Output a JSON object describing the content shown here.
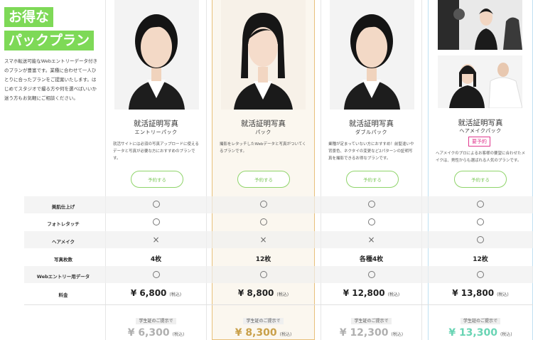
{
  "intro": {
    "heading_line1": "お得な",
    "heading_line2": "パックプラン",
    "description": "スマホ転送可能なWebエントリーデータ付きのプランが豊富です。業種に合わせて一人ひとりに合ったプランをご提案いたします。はじめてスタジオで撮る方や何を選べばいいか迷う方もお気軽にご相談ください。"
  },
  "plans": [
    {
      "title": "就活証明写真",
      "subtitle": "エントリーパック",
      "description": "就活サイトには必須の写真アップロードに使えるデータと写真が必要な方におすすめのプランです。",
      "button": "予約する",
      "badge": "",
      "price": "¥ 6,800",
      "student_price": "¥ 6,300"
    },
    {
      "title": "就活証明写真",
      "subtitle": "パック",
      "description": "撮影をレタッチしたWebデータと写真がついてくるプランです。",
      "button": "予約する",
      "badge": "",
      "price": "¥ 8,800",
      "student_price": "¥ 8,300"
    },
    {
      "title": "就活証明写真",
      "subtitle": "ダブルパック",
      "description": "業種が定まっていない方におすすめ！前髪違いや背景色、ネクタイの変更など2パターンの証明写真を撮影できるお得なプランです。",
      "button": "予約する",
      "badge": "",
      "price": "¥ 12,800",
      "student_price": "¥ 12,300"
    },
    {
      "title": "就活証明写真",
      "subtitle": "ヘアメイクパック",
      "description": "ヘアメイクのプロによるお客様の要望に合わせたメイクは、男性からも選ばれる人気のプランです。",
      "button": "予約する",
      "badge": "要予約",
      "price": "¥ 13,800",
      "student_price": "¥ 13,300"
    }
  ],
  "table": {
    "rows": [
      {
        "label": "美肌仕上げ",
        "values": [
          "○",
          "○",
          "○",
          "○"
        ]
      },
      {
        "label": "フォトレタッチ",
        "values": [
          "○",
          "○",
          "○",
          "○"
        ]
      },
      {
        "label": "ヘアメイク",
        "values": [
          "×",
          "×",
          "×",
          "○"
        ]
      },
      {
        "label": "写真枚数",
        "values": [
          "4枚",
          "12枚",
          "各種4枚",
          "12枚"
        ]
      },
      {
        "label": "Webエントリー用データ",
        "values": [
          "○",
          "○",
          "○",
          "○"
        ]
      }
    ],
    "price_label": "料金",
    "tax_note": "(税込)",
    "student_label": "学生証のご提示で"
  },
  "colors": {
    "accent_green": "#7ed957",
    "gold_border": "#e8c07a",
    "badge_pink": "#e0388e",
    "student_green": "#69d4b4"
  }
}
